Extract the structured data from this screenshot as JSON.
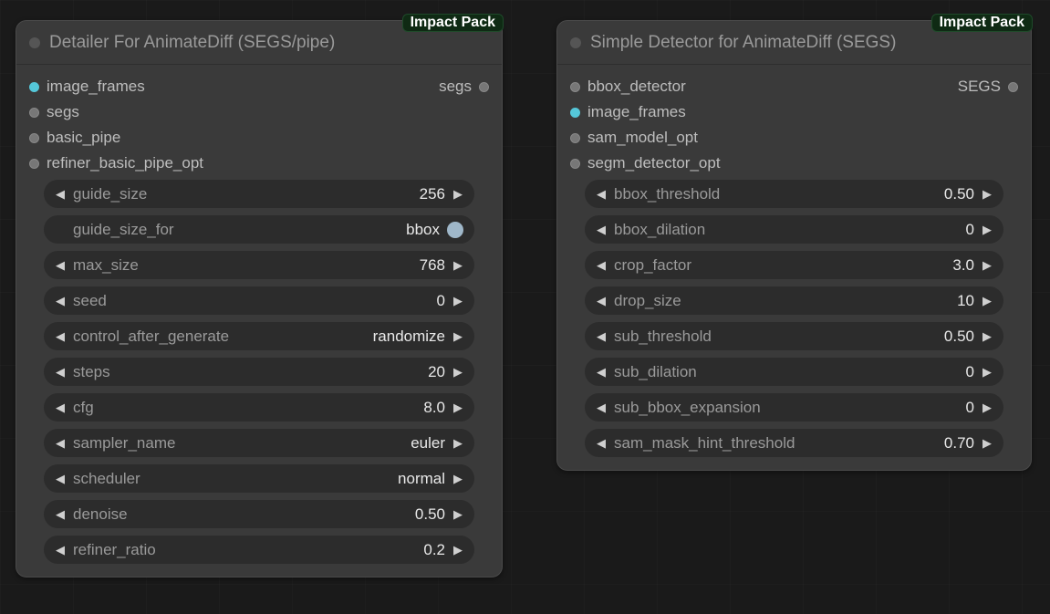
{
  "badge": "Impact Pack",
  "node1": {
    "title": "Detailer For AnimateDiff (SEGS/pipe)",
    "inputs": {
      "image_frames": "image_frames",
      "segs": "segs",
      "basic_pipe": "basic_pipe",
      "refiner_basic_pipe_opt": "refiner_basic_pipe_opt"
    },
    "outputs": {
      "segs": "segs"
    },
    "widgets": {
      "guide_size": {
        "label": "guide_size",
        "value": "256"
      },
      "guide_size_for": {
        "label": "guide_size_for",
        "value": "bbox"
      },
      "max_size": {
        "label": "max_size",
        "value": "768"
      },
      "seed": {
        "label": "seed",
        "value": "0"
      },
      "control_after_generate": {
        "label": "control_after_generate",
        "value": "randomize"
      },
      "steps": {
        "label": "steps",
        "value": "20"
      },
      "cfg": {
        "label": "cfg",
        "value": "8.0"
      },
      "sampler_name": {
        "label": "sampler_name",
        "value": "euler"
      },
      "scheduler": {
        "label": "scheduler",
        "value": "normal"
      },
      "denoise": {
        "label": "denoise",
        "value": "0.50"
      },
      "refiner_ratio": {
        "label": "refiner_ratio",
        "value": "0.2"
      }
    }
  },
  "node2": {
    "title": "Simple Detector for AnimateDiff (SEGS)",
    "inputs": {
      "bbox_detector": "bbox_detector",
      "image_frames": "image_frames",
      "sam_model_opt": "sam_model_opt",
      "segm_detector_opt": "segm_detector_opt"
    },
    "outputs": {
      "SEGS": "SEGS"
    },
    "widgets": {
      "bbox_threshold": {
        "label": "bbox_threshold",
        "value": "0.50"
      },
      "bbox_dilation": {
        "label": "bbox_dilation",
        "value": "0"
      },
      "crop_factor": {
        "label": "crop_factor",
        "value": "3.0"
      },
      "drop_size": {
        "label": "drop_size",
        "value": "10"
      },
      "sub_threshold": {
        "label": "sub_threshold",
        "value": "0.50"
      },
      "sub_dilation": {
        "label": "sub_dilation",
        "value": "0"
      },
      "sub_bbox_expansion": {
        "label": "sub_bbox_expansion",
        "value": "0"
      },
      "sam_mask_hint_threshold": {
        "label": "sam_mask_hint_threshold",
        "value": "0.70"
      }
    }
  }
}
